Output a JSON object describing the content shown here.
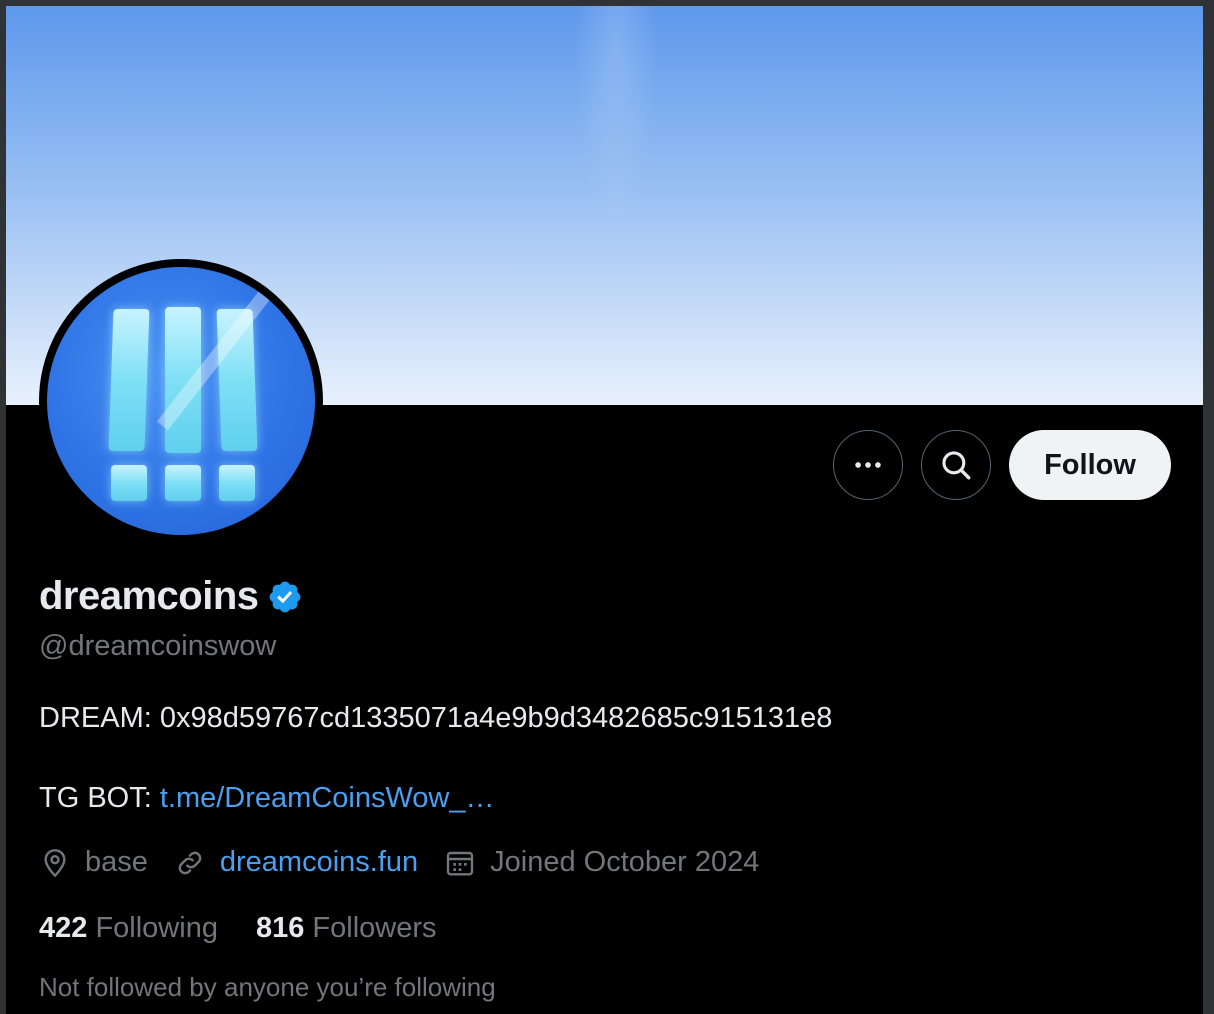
{
  "profile": {
    "display_name": "dreamcoins",
    "handle": "@dreamcoinswow",
    "verified": true,
    "bio_line1": "DREAM: 0x98d59767cd1335071a4e9b9d3482685c915131e8",
    "bio_line2_label": "TG BOT: ",
    "bio_line2_link": "t.me/DreamCoinsWow_…",
    "location": "base",
    "website": "dreamcoins.fun",
    "joined": "Joined October 2024"
  },
  "stats": {
    "following_count": "422",
    "following_label": "Following",
    "followers_count": "816",
    "followers_label": "Followers"
  },
  "social_context": "Not followed by anyone you’re following",
  "actions": {
    "more_icon": "more-icon",
    "search_icon": "search-icon",
    "follow_label": "Follow"
  },
  "colors": {
    "background": "#000000",
    "text_primary": "#e7e9ea",
    "text_secondary": "#71767b",
    "link": "#4a9ff0",
    "verified_badge": "#1d9bf0",
    "follow_button_bg": "#eff3f4"
  }
}
